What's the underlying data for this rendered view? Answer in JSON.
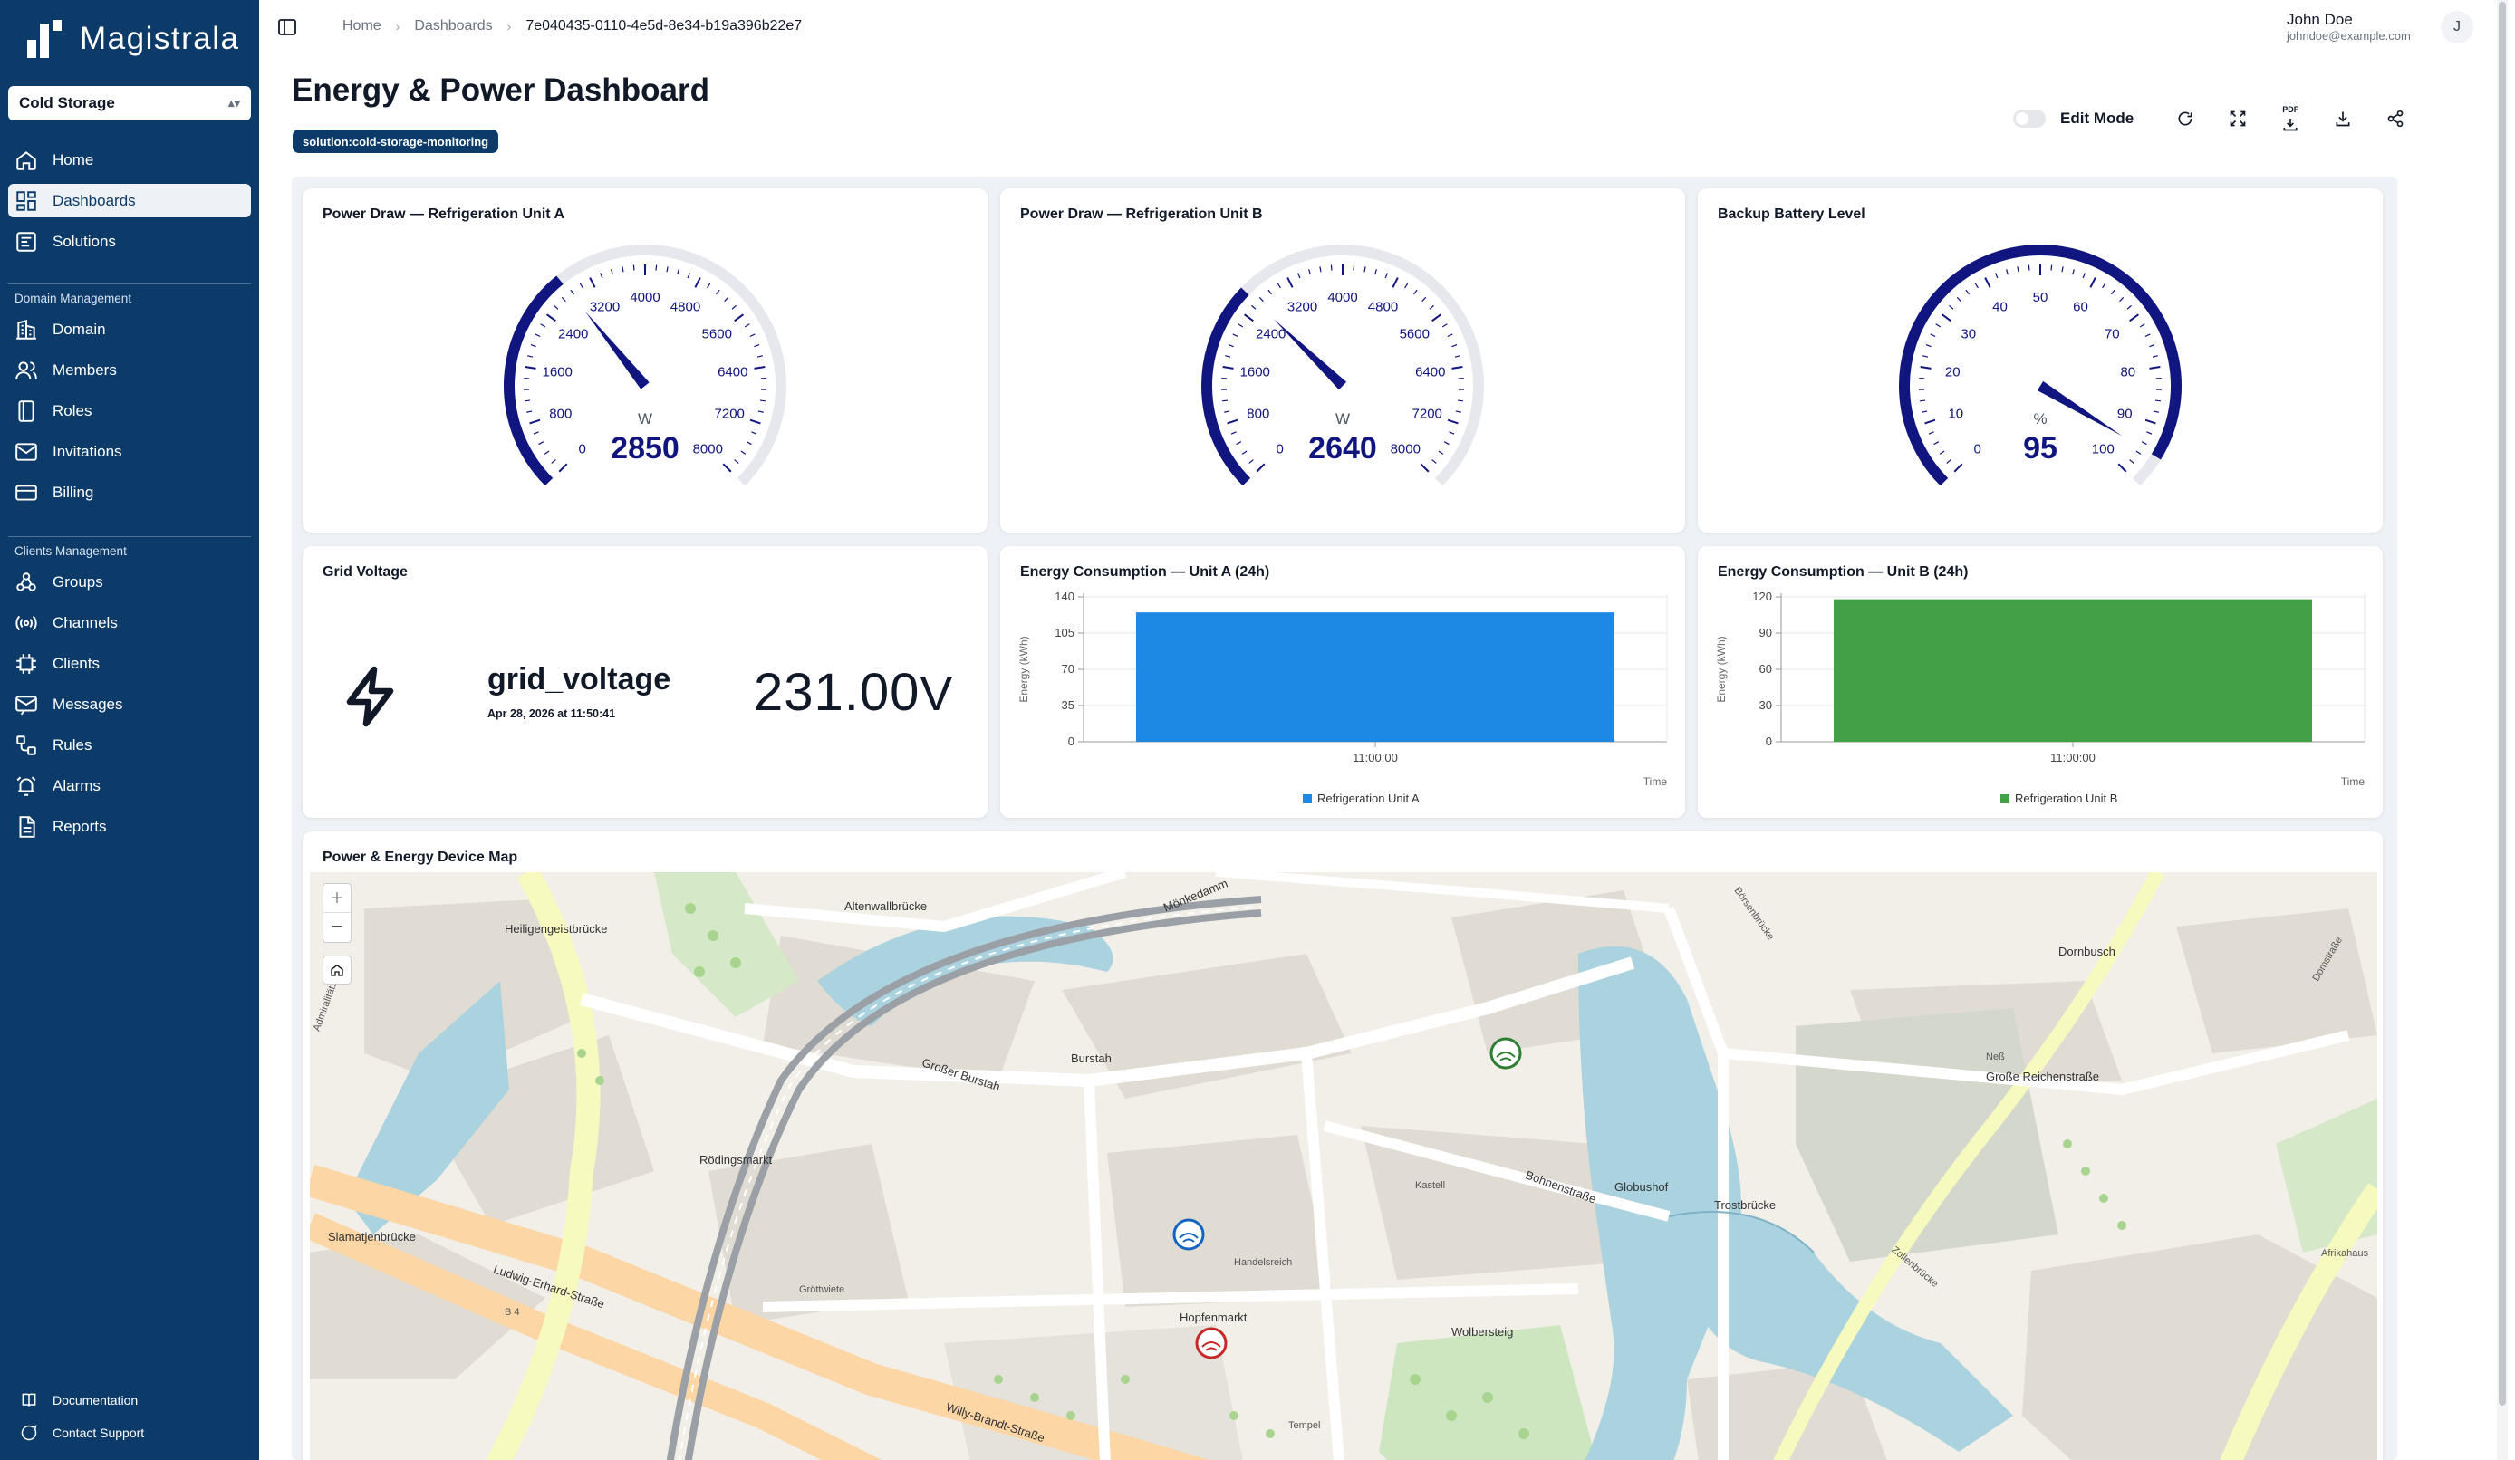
{
  "brand": {
    "name": "Magistrala"
  },
  "domain_select": {
    "value": "Cold Storage"
  },
  "nav": {
    "primary": [
      {
        "label": "Home",
        "icon": "home-icon",
        "active": false
      },
      {
        "label": "Dashboards",
        "icon": "dashboard-icon",
        "active": true
      },
      {
        "label": "Solutions",
        "icon": "solutions-icon",
        "active": false
      }
    ],
    "domain_section": "Domain Management",
    "domain_items": [
      {
        "label": "Domain",
        "icon": "building-icon"
      },
      {
        "label": "Members",
        "icon": "users-icon"
      },
      {
        "label": "Roles",
        "icon": "roles-icon"
      },
      {
        "label": "Invitations",
        "icon": "mail-icon"
      },
      {
        "label": "Billing",
        "icon": "credit-card-icon"
      }
    ],
    "clients_section": "Clients Management",
    "clients_items": [
      {
        "label": "Groups",
        "icon": "groups-icon"
      },
      {
        "label": "Channels",
        "icon": "radio-icon"
      },
      {
        "label": "Clients",
        "icon": "cpu-icon"
      },
      {
        "label": "Messages",
        "icon": "messages-icon"
      },
      {
        "label": "Rules",
        "icon": "workflow-icon"
      },
      {
        "label": "Alarms",
        "icon": "alarm-icon"
      },
      {
        "label": "Reports",
        "icon": "report-icon"
      }
    ],
    "footer": [
      {
        "label": "Documentation",
        "icon": "book-icon"
      },
      {
        "label": "Contact Support",
        "icon": "message-circle-icon"
      }
    ]
  },
  "breadcrumb": {
    "home": "Home",
    "dashboards": "Dashboards",
    "current": "7e040435-0110-4e5d-8e34-b19a396b22e7"
  },
  "user": {
    "name": "John Doe",
    "email": "johndoe@example.com",
    "initial": "J"
  },
  "page": {
    "title": "Energy & Power Dashboard",
    "tag": "solution:cold-storage-monitoring"
  },
  "toolbar": {
    "edit_mode_label": "Edit Mode",
    "edit_mode_on": false,
    "pdf_label": "PDF"
  },
  "widgets": {
    "gauge_a": {
      "title": "Power Draw — Refrigeration Unit A",
      "value": 2850,
      "value_text": "2850",
      "unit": "W",
      "min": 0,
      "max": 8000,
      "ticks": [
        "0",
        "800",
        "1600",
        "2400",
        "3200",
        "4000",
        "4800",
        "5600",
        "6400",
        "7200",
        "8000"
      ]
    },
    "gauge_b": {
      "title": "Power Draw — Refrigeration Unit B",
      "value": 2640,
      "value_text": "2640",
      "unit": "W",
      "min": 0,
      "max": 8000,
      "ticks": [
        "0",
        "800",
        "1600",
        "2400",
        "3200",
        "4000",
        "4800",
        "5600",
        "6400",
        "7200",
        "8000"
      ]
    },
    "gauge_c": {
      "title": "Backup Battery Level",
      "value": 95,
      "value_text": "95",
      "unit": "%",
      "min": 0,
      "max": 100,
      "ticks": [
        "0",
        "10",
        "20",
        "30",
        "40",
        "50",
        "60",
        "70",
        "80",
        "90",
        "100"
      ]
    },
    "grid_voltage": {
      "title": "Grid Voltage",
      "name": "grid_voltage",
      "timestamp": "Apr 28, 2026 at 11:50:41",
      "value": "231.00",
      "unit": "V"
    },
    "energy_a": {
      "title": "Energy Consumption — Unit A (24h)"
    },
    "energy_b": {
      "title": "Energy Consumption — Unit B (24h)"
    },
    "map": {
      "title": "Power & Energy Device Map"
    }
  },
  "chart_data": [
    {
      "type": "bar",
      "title": "Energy Consumption — Unit A (24h)",
      "categories": [
        "11:00:00"
      ],
      "series": [
        {
          "name": "Refrigeration Unit A",
          "values": [
            125
          ],
          "color": "#1e88e5"
        }
      ],
      "xlabel": "Time",
      "ylabel": "Energy (kWh)",
      "ylim": [
        0,
        140
      ],
      "yticks": [
        0,
        35,
        70,
        105,
        140
      ],
      "legend": "bottom"
    },
    {
      "type": "bar",
      "title": "Energy Consumption — Unit B (24h)",
      "categories": [
        "11:00:00"
      ],
      "series": [
        {
          "name": "Refrigeration Unit B",
          "values": [
            118
          ],
          "color": "#43a047"
        }
      ],
      "xlabel": "Time",
      "ylabel": "Energy (kWh)",
      "ylim": [
        0,
        120
      ],
      "yticks": [
        0,
        30,
        60,
        90,
        120
      ],
      "legend": "bottom"
    }
  ],
  "map_labels": [
    {
      "text": "Heiligengeistbrücke"
    },
    {
      "text": "Altenwallbrücke"
    },
    {
      "text": "Mönkedamm"
    },
    {
      "text": "Burstah"
    },
    {
      "text": "Großer Burstah"
    },
    {
      "text": "Rödingsmarkt"
    },
    {
      "text": "Slamatjenbrücke"
    },
    {
      "text": "Ludwig-Erhard-Straße"
    },
    {
      "text": "Willy-Brandt-Straße"
    },
    {
      "text": "Hopfenmarkt"
    },
    {
      "text": "Wolbersteig"
    },
    {
      "text": "Bohnenstraße"
    },
    {
      "text": "Globushof"
    },
    {
      "text": "Trostbrücke"
    },
    {
      "text": "Große Reichenstraße"
    },
    {
      "text": "Dornbusch"
    },
    {
      "text": "Handelsreich"
    },
    {
      "text": "Kastell"
    },
    {
      "text": "Afrikahaus"
    },
    {
      "text": "Neß"
    },
    {
      "text": "Börsenbrücke"
    },
    {
      "text": "Admiralitätstraße"
    },
    {
      "text": "Domstraße"
    },
    {
      "text": "Zollenbrücke"
    },
    {
      "text": "Gröttwiete"
    },
    {
      "text": "Tempel"
    },
    {
      "text": "B 4"
    }
  ]
}
